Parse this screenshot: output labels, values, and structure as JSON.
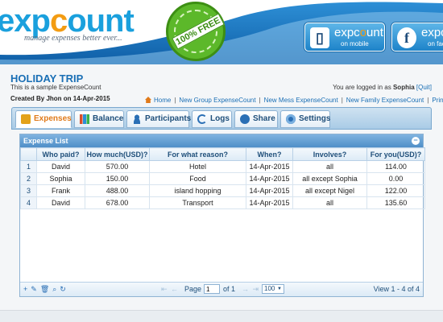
{
  "brand": {
    "logo_exp": "exp",
    "logo_o": "c",
    "logo_rest": "ount",
    "tagline": "manage expenses better ever...",
    "badge_text": "100% FREE"
  },
  "promos": {
    "mobile_title_a": "expc",
    "mobile_title_o": "o",
    "mobile_title_b": "unt",
    "mobile_sub": "on mobile",
    "fb_title": "expc",
    "fb_sub": "on face"
  },
  "trip": {
    "title": "HOLIDAY TRIP",
    "description": "This is a sample ExpenseCount",
    "created_by": "Created By Jhon on 14-Apr-2015"
  },
  "session": {
    "logged_prefix": "You are logged in as",
    "user": "Sophia",
    "quit": "[Quit]"
  },
  "toplinks": {
    "home": "Home",
    "new_group": "New Group ExpenseCount",
    "new_mess": "New Mess ExpenseCount",
    "new_family": "New Family ExpenseCount",
    "print": "Print"
  },
  "tabs": {
    "expenses": "Expenses",
    "balance": "Balance",
    "participants": "Participants",
    "logs": "Logs",
    "share": "Share",
    "settings": "Settings"
  },
  "grid": {
    "title": "Expense List",
    "headers": {
      "who": "Who paid?",
      "how_much": "How much(USD)?",
      "reason": "For what reason?",
      "when": "When?",
      "involves": "Involves?",
      "for_you": "For you(USD)?"
    },
    "rows": [
      {
        "n": "1",
        "who": "David",
        "amount": "570.00",
        "reason": "Hotel",
        "when": "14-Apr-2015",
        "involves": "all",
        "for_you": "114.00"
      },
      {
        "n": "2",
        "who": "Sophia",
        "amount": "150.00",
        "reason": "Food",
        "when": "14-Apr-2015",
        "involves": "all except Sophia",
        "for_you": "0.00"
      },
      {
        "n": "3",
        "who": "Frank",
        "amount": "488.00",
        "reason": "island hopping",
        "when": "14-Apr-2015",
        "involves": "all except Nigel",
        "for_you": "122.00"
      },
      {
        "n": "4",
        "who": "David",
        "amount": "678.00",
        "reason": "Transport",
        "when": "14-Apr-2015",
        "involves": "all",
        "for_you": "135.60"
      }
    ]
  },
  "pager": {
    "page_label": "Page",
    "page_value": "1",
    "of_label": "of 1",
    "rows_per_page": "100",
    "view_text": "View 1 - 4 of 4"
  },
  "colors": {
    "accent": "#1a6fb5",
    "active_tab": "#e07a1a",
    "header_blue": "#1d83c9"
  }
}
